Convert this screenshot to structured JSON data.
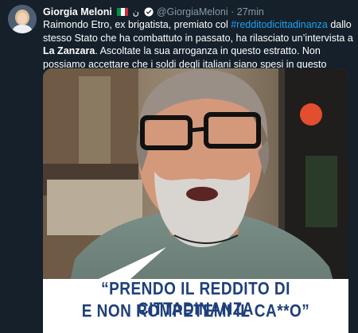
{
  "author": {
    "name": "Giorgia Meloni",
    "arabic_suffix": "ن",
    "handle": "@GiorgiaMeloni",
    "separator": "·",
    "time": "27min"
  },
  "tweet": {
    "text_part1": "Raimondo Etro, ex brigatista, premiato col ",
    "hashtag": "#redditodicittadinanza",
    "text_part2": " dallo stesso Stato che ha combattuto in passato, ha rilasciato un’intervista a ",
    "bold_text": "La Zanzara",
    "text_part3": ". Ascoltate la sua arroganza in questo estratto. Non possiamo accettare che i soldi degli italiani siano spesi in questo modo"
  },
  "media": {
    "caption_line1": "“PRENDO IL REDDITO DI CITTADINANZA",
    "caption_line2": "E NON ROMPETEMI IL CA**O”"
  },
  "colors": {
    "background": "#15202b",
    "link": "#1da1f2",
    "muted": "#8899a6",
    "caption": "#1e3f7a"
  },
  "icons": [
    "avatar",
    "italian-flag-icon",
    "verified-badge-icon"
  ]
}
